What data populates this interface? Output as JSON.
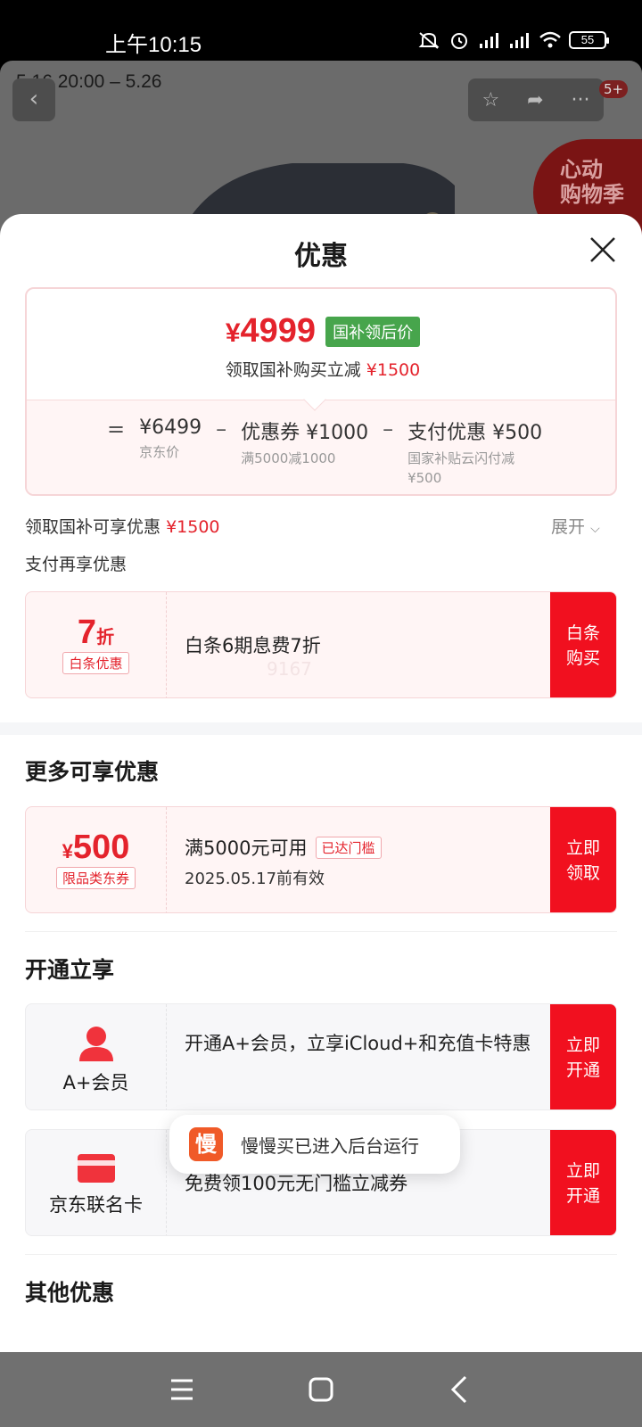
{
  "status_bar": {
    "time": "上午10:15",
    "battery": "55"
  },
  "background_page": {
    "event_dates": "5.16 20:00 – 5.26",
    "cart_count": "5+",
    "promo_badge": "心动购物季"
  },
  "sheet": {
    "title": "优惠",
    "price_card": {
      "yen": "¥",
      "final_price": "4999",
      "final_tag": "国补领后价",
      "discount_text": "领取国补购买立减",
      "discount_value": "¥1500",
      "formula": {
        "eq": "=",
        "minus": "–",
        "jd_price": "¥6499",
        "jd_price_label": "京东价",
        "coupon": "优惠券 ¥1000",
        "coupon_note": "满5000减1000",
        "pay": "支付优惠 ¥500",
        "pay_note_1": "国家补贴云闪付减",
        "pay_note_2": "¥500"
      }
    },
    "subsidy_line": {
      "text": "领取国补可享优惠",
      "value": "¥1500",
      "expand_label": "展开"
    },
    "pay_more_label": "支付再享优惠",
    "baitiao_offer": {
      "discount_num": "7",
      "discount_unit": "折",
      "badge": "白条优惠",
      "title": "白条6期息费7折",
      "watermark": "9167",
      "action": "白条购买"
    },
    "more_section": {
      "title": "更多可享优惠",
      "coupon": {
        "yen": "¥",
        "amount": "500",
        "badge": "限品类东券",
        "title": "满5000元可用",
        "status": "已达门槛",
        "valid": "2025.05.17前有效",
        "action": "立即领取"
      }
    },
    "open_section": {
      "title": "开通立享",
      "items": [
        {
          "label": "A+会员",
          "desc": "开通A+会员，立享iCloud+和充值卡特惠",
          "action": "立即开通"
        },
        {
          "label": "京东联名卡",
          "desc": "免费领100元无门槛立减券",
          "action": "立即开通"
        }
      ]
    },
    "other_section": {
      "title": "其他优惠"
    }
  },
  "toast": {
    "app_icon_char": "慢",
    "message": "慢慢买已进入后台运行"
  },
  "colors": {
    "accent_red": "#e4232c",
    "action_red": "#f1101f",
    "tag_green": "#47a54c"
  }
}
